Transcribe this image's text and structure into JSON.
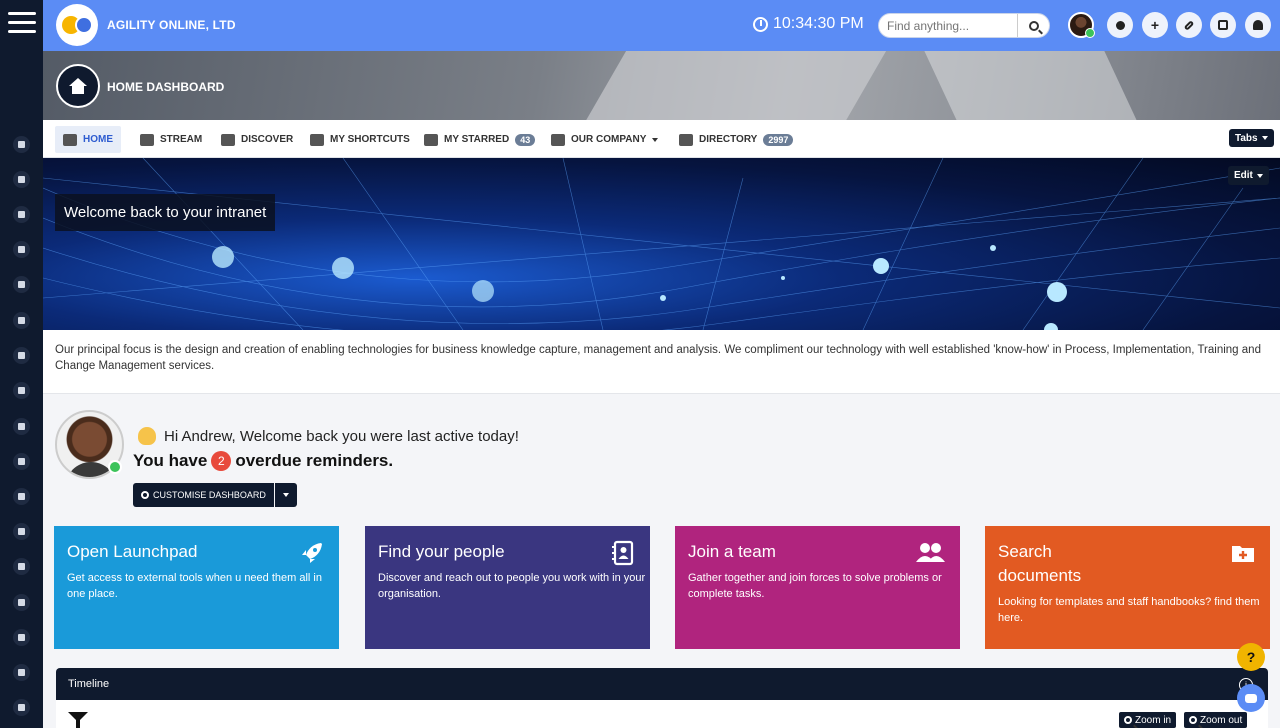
{
  "app": {
    "company_name": "AGILITY ONLINE, LTD",
    "clock": "10:34:30 PM",
    "search_placeholder": "Find anything...",
    "colors": {
      "topbar": "#5b8cf5",
      "rail": "#0f1a2e",
      "accent": "#2e5cd0"
    }
  },
  "header": {
    "title": "HOME DASHBOARD"
  },
  "rail_icons": [
    "home-icon",
    "people-icon",
    "support-icon",
    "tags-icon",
    "card-icon",
    "square-icon",
    "folder-icon",
    "rocket-icon",
    "search-icon",
    "team-icon",
    "chat-icon",
    "calendar-icon",
    "inbox-icon",
    "pin-icon",
    "stopwatch-icon",
    "list-icon",
    "pages-icon"
  ],
  "tabs": [
    {
      "label": "HOME",
      "icon": "home-icon"
    },
    {
      "label": "STREAM",
      "icon": "stream-icon"
    },
    {
      "label": "DISCOVER",
      "icon": "search-icon"
    },
    {
      "label": "MY SHORTCUTS",
      "icon": "hand-pointer-icon"
    },
    {
      "label": "MY STARRED",
      "icon": "star-icon",
      "badge": "43"
    },
    {
      "label": "OUR COMPANY",
      "icon": "building-icon"
    },
    {
      "label": "DIRECTORY",
      "icon": "address-book-icon",
      "badge": "2997"
    }
  ],
  "tabs_button": "Tabs",
  "edit_button": "Edit",
  "banner": {
    "welcome": "Welcome back to your intranet"
  },
  "description": "Our principal focus is the design and creation of enabling technologies for business knowledge capture, management and analysis. We compliment our technology with well established 'know-how' in Process, Implementation, Training and Change Management services.",
  "greeting": {
    "hi": "Hi Andrew, Welcome back you were last active today!",
    "you_have": "You have",
    "count": "2",
    "overdue": "overdue reminders.",
    "customise": "CUSTOMISE DASHBOARD"
  },
  "cards": [
    {
      "title": "Open Launchpad",
      "text": "Get access to external tools when u need them all in one place.",
      "color": "#1a9ad9",
      "icon": "rocket-icon"
    },
    {
      "title": "Find your people",
      "text": "Discover and reach out to people you work with in your organisation.",
      "color": "#3a3680",
      "icon": "address-book-icon"
    },
    {
      "title": "Join a team",
      "text": "Gather together and join forces to solve problems or complete tasks.",
      "color": "#b0247e",
      "icon": "users-icon"
    },
    {
      "title": "Search documents",
      "text": "Looking for templates and staff handbooks? find them here.",
      "color": "#e25a22",
      "icon": "folder-plus-icon"
    }
  ],
  "timeline": {
    "title": "Timeline",
    "zoom_in": "Zoom in",
    "zoom_out": "Zoom out",
    "info": "i"
  },
  "help": "?"
}
